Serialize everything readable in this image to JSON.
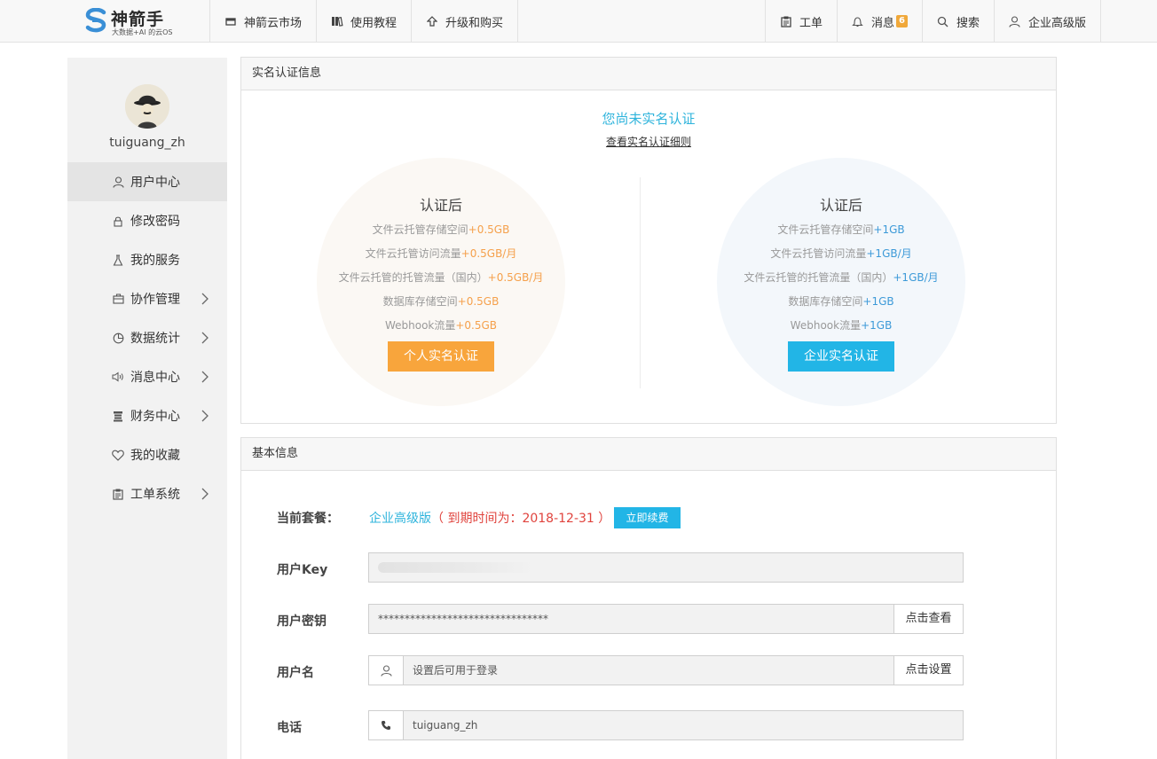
{
  "logo": {
    "name": "神箭手",
    "tagline": "大数据+AI 的云OS"
  },
  "nav_left": [
    {
      "label": "神箭云市场",
      "icon": "market-icon"
    },
    {
      "label": "使用教程",
      "icon": "book-icon"
    },
    {
      "label": "升级和购买",
      "icon": "upgrade-icon"
    }
  ],
  "nav_right": {
    "ticket": "工单",
    "messages": "消息",
    "message_count": "6",
    "search": "搜索",
    "account": "企业高级版"
  },
  "sidebar": {
    "username": "tuiguang_zh",
    "items": [
      {
        "label": "用户中心",
        "icon": "user-icon",
        "active": true,
        "chevron": false
      },
      {
        "label": "修改密码",
        "icon": "lock-icon",
        "active": false,
        "chevron": false
      },
      {
        "label": "我的服务",
        "icon": "flask-icon",
        "active": false,
        "chevron": false
      },
      {
        "label": "协作管理",
        "icon": "briefcase-icon",
        "active": false,
        "chevron": true
      },
      {
        "label": "数据统计",
        "icon": "pie-chart-icon",
        "active": false,
        "chevron": true
      },
      {
        "label": "消息中心",
        "icon": "speaker-icon",
        "active": false,
        "chevron": true
      },
      {
        "label": "财务中心",
        "icon": "coins-icon",
        "active": false,
        "chevron": true
      },
      {
        "label": "我的收藏",
        "icon": "heart-icon",
        "active": false,
        "chevron": false
      },
      {
        "label": "工单系统",
        "icon": "clipboard-icon",
        "active": false,
        "chevron": true
      }
    ]
  },
  "cert": {
    "header": "实名认证信息",
    "status": "您尚未实名认证",
    "details_link": "查看实名认证细则",
    "personal": {
      "title": "认证后",
      "lines": [
        {
          "text": "文件云托管存储空间",
          "bonus": "+0.5GB"
        },
        {
          "text": "文件云托管访问流量",
          "bonus": "+0.5GB/月"
        },
        {
          "text": "文件云托管的托管流量（国内）",
          "bonus": "+0.5GB/月"
        },
        {
          "text": "数据库存储空间",
          "bonus": "+0.5GB"
        },
        {
          "text": "Webhook流量",
          "bonus": "+0.5GB"
        }
      ],
      "button": "个人实名认证"
    },
    "enterprise": {
      "title": "认证后",
      "lines": [
        {
          "text": "文件云托管存储空间",
          "bonus": "+1GB"
        },
        {
          "text": "文件云托管访问流量",
          "bonus": "+1GB/月"
        },
        {
          "text": "文件云托管的托管流量（国内）",
          "bonus": "+1GB/月"
        },
        {
          "text": "数据库存储空间",
          "bonus": "+1GB"
        },
        {
          "text": "Webhook流量",
          "bonus": "+1GB"
        }
      ],
      "button": "企业实名认证"
    }
  },
  "basic": {
    "header": "基本信息",
    "plan_label": "当前套餐：",
    "plan_name": "企业高级版",
    "plan_expiry": "（ 到期时间为：2018-12-31 ）",
    "renew_button": "立即续费",
    "key_label": "用户Key",
    "secret_label": "用户密钥",
    "secret_value": "********************************",
    "secret_action": "点击查看",
    "username_label": "用户名",
    "username_placeholder": "设置后可用于登录",
    "username_action": "点击设置",
    "phone_label": "电话",
    "phone_value": "tuiguang_zh"
  },
  "colors": {
    "accent_blue": "#22b5e6",
    "accent_orange": "#f8a53c",
    "danger": "#e0433d"
  }
}
